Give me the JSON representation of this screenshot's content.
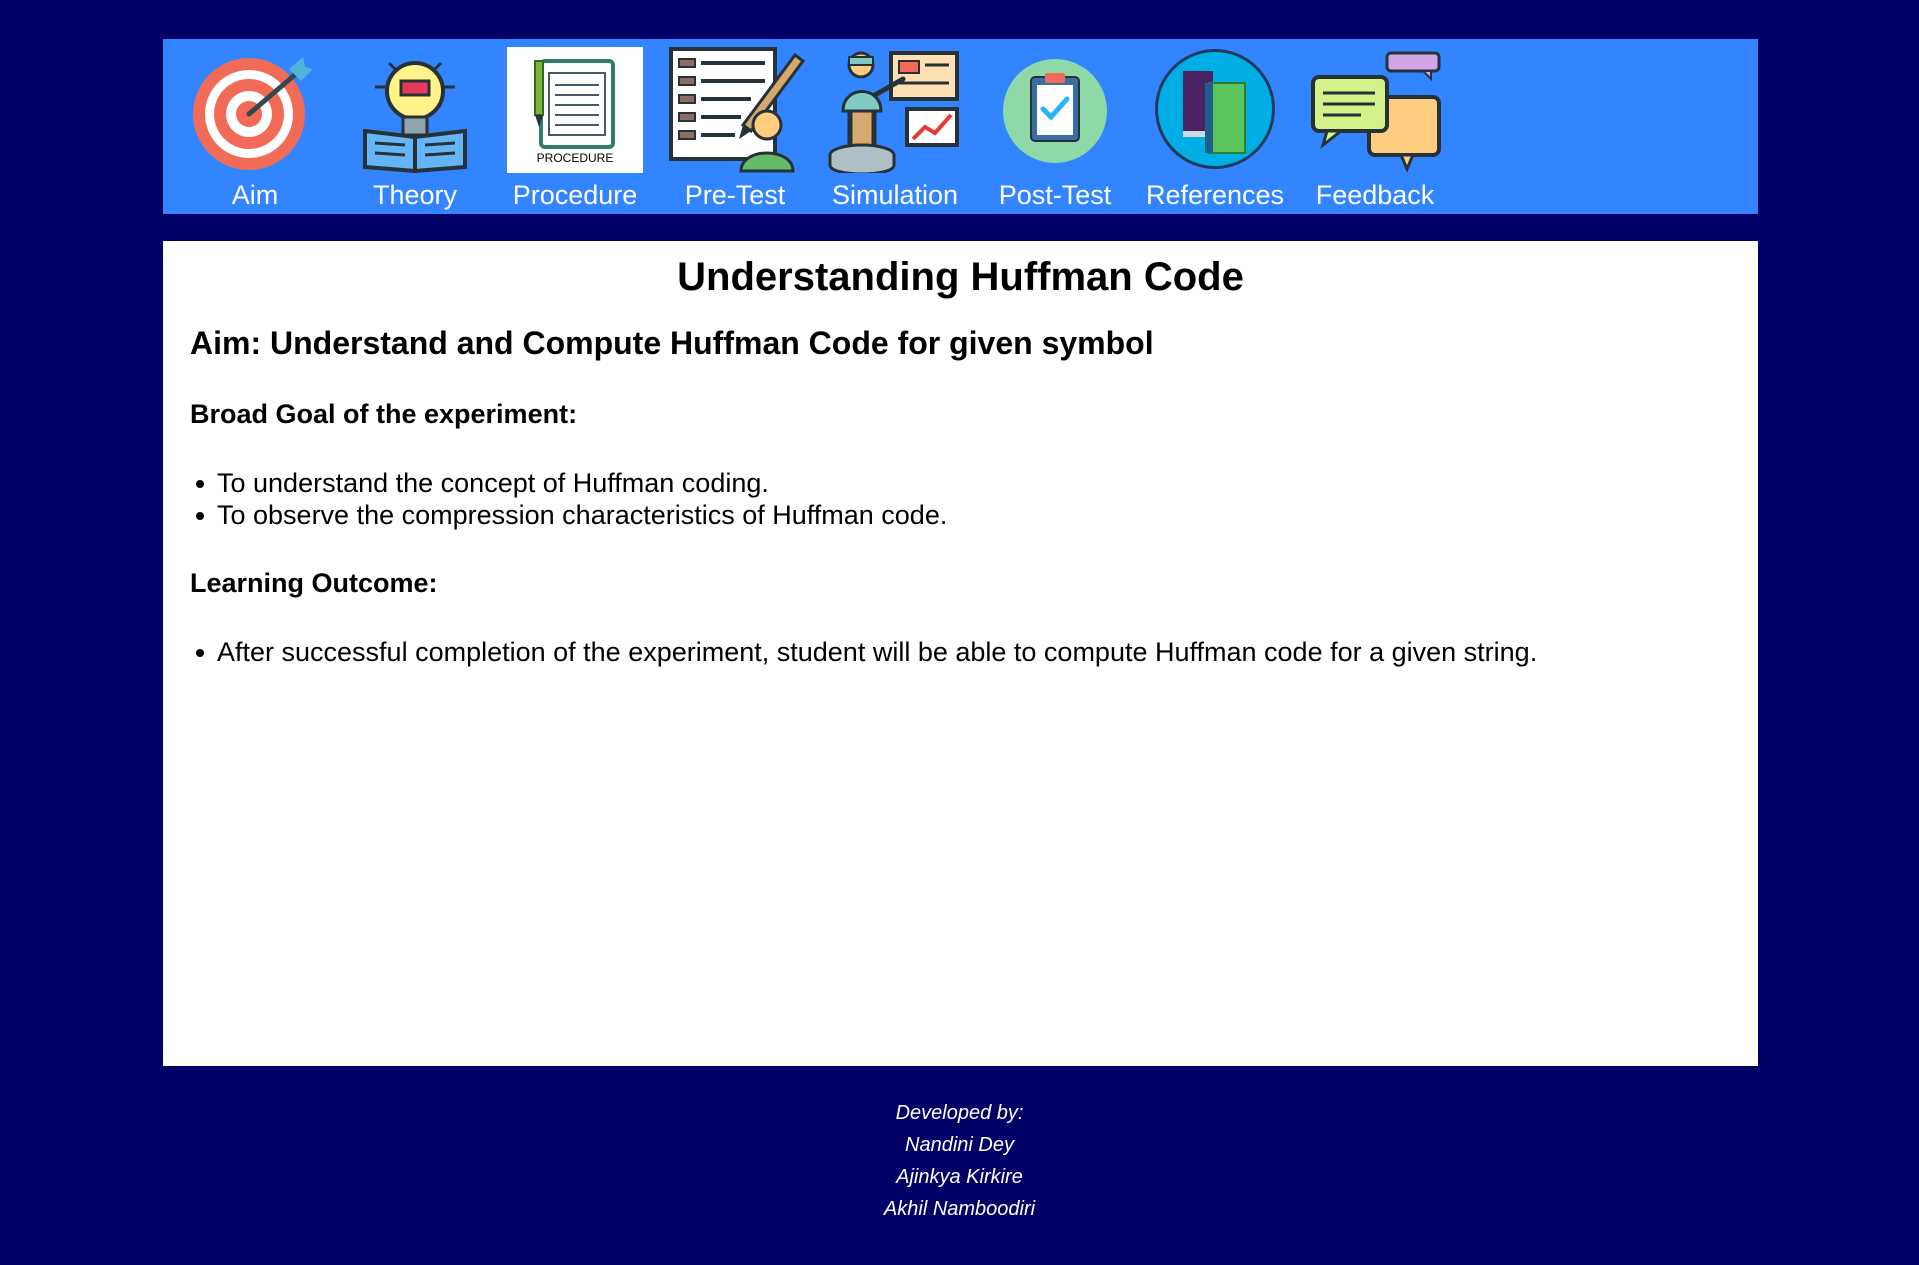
{
  "nav": {
    "items": [
      {
        "label": "Aim",
        "icon": "target-arrow-icon"
      },
      {
        "label": "Theory",
        "icon": "lightbulb-book-icon"
      },
      {
        "label": "Procedure",
        "icon": "procedure-clipboard-icon",
        "icon_text": "PROCEDURE"
      },
      {
        "label": "Pre-Test",
        "icon": "test-sheet-pencil-icon"
      },
      {
        "label": "Simulation",
        "icon": "presenter-chart-icon"
      },
      {
        "label": "Post-Test",
        "icon": "checklist-clipboard-icon"
      },
      {
        "label": "References",
        "icon": "books-icon"
      },
      {
        "label": "Feedback",
        "icon": "chat-bubbles-icon"
      }
    ]
  },
  "main": {
    "title": "Understanding Huffman Code",
    "aim": "Aim: Understand and Compute Huffman Code for given symbol",
    "broad_goal": {
      "heading": "Broad Goal of the experiment:",
      "items": [
        "To understand the concept of Huffman coding.",
        "To observe the compression characteristics of Huffman code."
      ]
    },
    "learning_outcome": {
      "heading": "Learning Outcome:",
      "items": [
        "After successful completion of the experiment, student will be able to compute Huffman code for a given string."
      ]
    }
  },
  "footer": {
    "developed_by": "Developed by:",
    "developers": [
      "Nandini Dey",
      "Ajinkya Kirkire",
      "Akhil Namboodiri"
    ]
  },
  "colors": {
    "page_background": "#000066",
    "navbar_background": "#3385ff",
    "content_background": "#ffffff"
  }
}
